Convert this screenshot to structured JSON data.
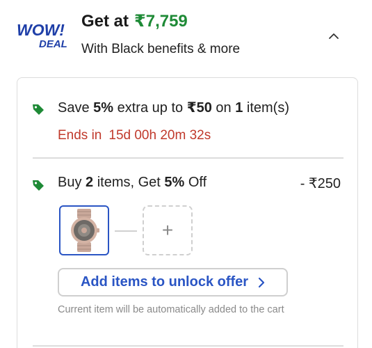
{
  "header": {
    "logo_line1": "WOW!",
    "logo_line2": "DEAL",
    "price_prefix": "Get at",
    "price": "₹7,759",
    "subtitle": "With Black benefits & more"
  },
  "offers": [
    {
      "text_prefix": "Save ",
      "percent": "5%",
      "text_mid": " extra up to ",
      "cap": "₹50",
      "text_on": " on ",
      "count": "1",
      "text_suffix": " item(s)",
      "timer_label": "Ends in",
      "timer_value": "15d 00h 20m 32s"
    },
    {
      "text_buy": "Buy ",
      "qty": "2",
      "text_get": " items, Get ",
      "percent": "5%",
      "text_off": " Off",
      "discount": "- ₹250",
      "add_symbol": "+",
      "button_label": "Add items to unlock offer",
      "note": "Current item will be automatically added to the cart"
    }
  ],
  "colors": {
    "price_green": "#1e8a36",
    "tag_green": "#1e8a36",
    "timer_red": "#c0392b",
    "accent_blue": "#2a55c4",
    "logo_blue": "#1f3fa8"
  },
  "icons": {
    "tag": "tag-icon",
    "collapse": "chevron-up-icon",
    "arrow": "chevron-right-icon",
    "product": "watch-thumbnail"
  }
}
